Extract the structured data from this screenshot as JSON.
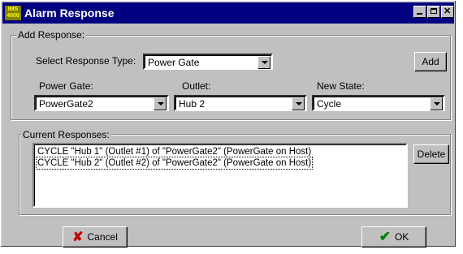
{
  "window": {
    "app_icon_text": "IMS 4000",
    "title": "Alarm Response"
  },
  "add_response": {
    "group_label": "Add Response:",
    "select_type_label": "Select Response Type:",
    "response_type_value": "Power Gate",
    "add_button": "Add",
    "power_gate_label": "Power Gate:",
    "power_gate_value": "PowerGate2",
    "outlet_label": "Outlet:",
    "outlet_value": "Hub 2",
    "new_state_label": "New State:",
    "new_state_value": "Cycle"
  },
  "current_responses": {
    "group_label": "Current Responses:",
    "items": [
      "CYCLE \"Hub 1\" (Outlet #1) of \"PowerGate2\" (PowerGate on Host)",
      "CYCLE \"Hub 2\" (Outlet #2) of \"PowerGate2\" (PowerGate on Host)"
    ],
    "delete_button": "Delete"
  },
  "footer": {
    "cancel_button": "Cancel",
    "ok_button": "OK"
  }
}
